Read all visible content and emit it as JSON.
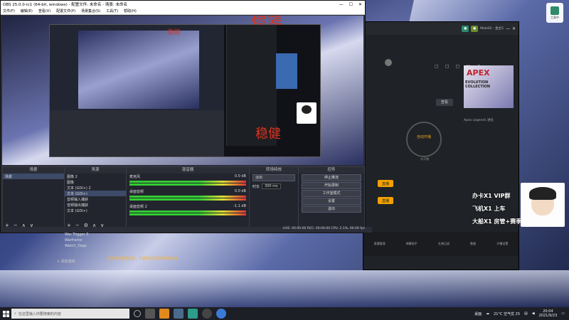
{
  "desktop": {
    "icon_label": "工具中"
  },
  "obs": {
    "title": "OBS 25.0.0-rc1 (64-bit, windows) - 配置文件: 未命名 - 场景: 未命名",
    "menu": [
      "文件(F)",
      "编辑(E)",
      "查看(V)",
      "配置文件(P)",
      "场景集合(S)",
      "工具(T)",
      "帮助(H)"
    ],
    "watermark": "稳健",
    "docks": {
      "scenes": {
        "title": "场景",
        "items": [
          "场景"
        ]
      },
      "sources": {
        "title": "来源",
        "items": [
          "图像 2",
          "图像",
          "文本 (GDI+) 2",
          "文本 (GDI+)",
          "音频输入捕获",
          "音频输出捕获",
          "文本 (GDI+)"
        ]
      },
      "mixer": {
        "title": "混音器",
        "channels": [
          {
            "name": "麦克风",
            "db": "0.0 dB"
          },
          {
            "name": "桌面音频",
            "db": "0.0 dB"
          },
          {
            "name": "桌面音频 2",
            "db": "-1.1 dB"
          }
        ]
      },
      "transitions": {
        "title": "转场特效",
        "type": "淡出",
        "duration_label": "时长",
        "duration_value": "300 ms"
      },
      "controls": {
        "title": "控件",
        "buttons": [
          "停止推流",
          "开始录制",
          "工作室模式",
          "设置",
          "退出"
        ]
      }
    },
    "status": "LIVE: 00:00:00   REC: 00:00:00   CPU: 2.1%, 60.00 fps"
  },
  "app": {
    "header_badge": "Mole02 - 金主5",
    "game_title": "APEX",
    "collection": "EVOLUTION COLLECTION",
    "game_sub": "Apex Legends  进化",
    "detail_btn": "查看",
    "stream_btn": "自动开播",
    "status_text": "未开播",
    "orange_labels": [
      "直播",
      "直播"
    ],
    "bottom_items": [
      "直播管理",
      "弹幕助手",
      "礼物记录",
      "数据",
      "开播设置",
      "全部"
    ],
    "games": [
      "War Trigger 3",
      "Warframe",
      "Watch_Dogs"
    ],
    "add_game": "添加游戏",
    "notice": "欢迎使用直播伴侣，开播前请检查网络和设备"
  },
  "overlay": {
    "lines": [
      "办卡X1 VIP群",
      "飞机X1 上车",
      "大船X1 房管+赛季霸金奖励"
    ]
  },
  "taskbar": {
    "search_placeholder": "在这里输入你要搜索的内容",
    "weather": "21°C 空气优 25",
    "time": "20:04",
    "date": "2021/9/23",
    "tray_label": "桌面"
  }
}
